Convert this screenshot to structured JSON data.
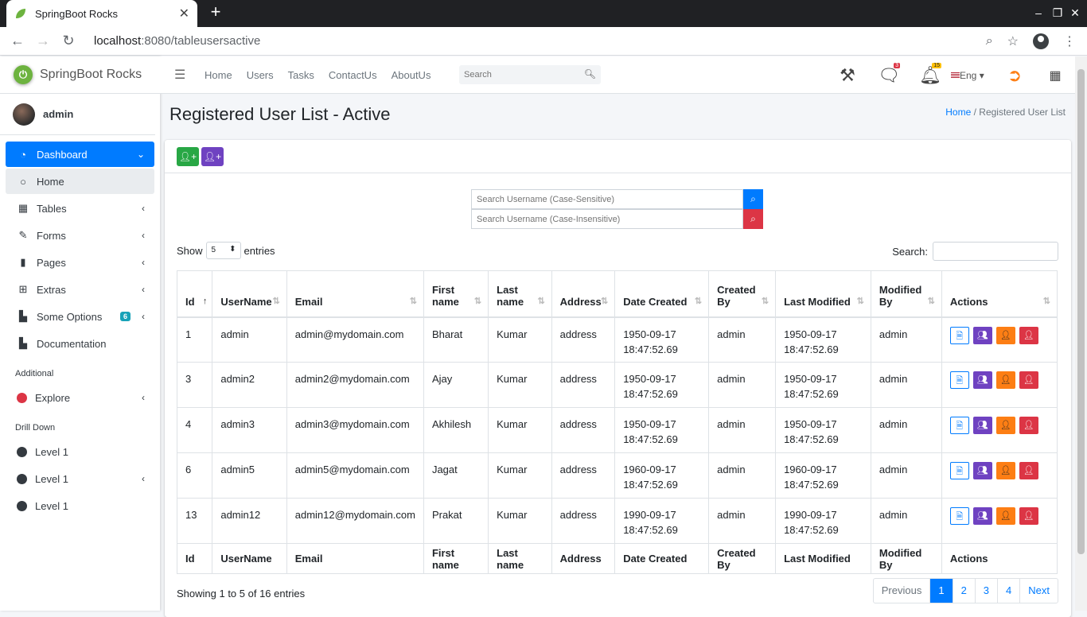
{
  "browser": {
    "tab_title": "SpringBoot Rocks",
    "url_host": "localhost",
    "url_path": ":8080/tableusersactive"
  },
  "sidebar": {
    "brand": "SpringBoot Rocks",
    "user": "admin",
    "items": [
      {
        "label": "Dashboard",
        "icon": "tachometer-icon"
      },
      {
        "label": "Home",
        "icon": "circle-icon"
      },
      {
        "label": "Tables",
        "icon": "table-icon"
      },
      {
        "label": "Forms",
        "icon": "edit-icon"
      },
      {
        "label": "Pages",
        "icon": "book-icon"
      },
      {
        "label": "Extras",
        "icon": "plus-square-icon"
      },
      {
        "label": "Some Options",
        "icon": "file-icon",
        "badge": "6"
      },
      {
        "label": "Documentation",
        "icon": "file-icon"
      }
    ],
    "header_additional": "Additional",
    "explore": "Explore",
    "header_drilldown": "Drill Down",
    "levels": [
      "Level 1",
      "Level 1",
      "Level 1"
    ]
  },
  "topnav": {
    "links": [
      "Home",
      "Users",
      "Tasks",
      "ContactUs",
      "AboutUs"
    ],
    "search_placeholder": "Search",
    "messages_badge": "3",
    "notifications_badge": "15",
    "language": "Eng"
  },
  "page": {
    "title": "Registered User List - Active",
    "breadcrumb_home": "Home",
    "breadcrumb_current": "Registered User List"
  },
  "search": {
    "case_sensitive_placeholder": "Search Username (Case-Sensitive)",
    "case_insensitive_placeholder": "Search Username (Case-Insensitive)"
  },
  "datatable": {
    "show_label": "Show",
    "page_length": "5",
    "entries_label": "entries",
    "search_label": "Search:",
    "columns": [
      "Id",
      "UserName",
      "Email",
      "First name",
      "Last name",
      "Address",
      "Date Created",
      "Created By",
      "Last Modified",
      "Modified By",
      "Actions"
    ],
    "rows": [
      [
        "1",
        "admin",
        "admin@mydomain.com",
        "Bharat",
        "Kumar",
        "address",
        "1950-09-17 18:47:52.69",
        "admin",
        "1950-09-17 18:47:52.69",
        "admin"
      ],
      [
        "3",
        "admin2",
        "admin2@mydomain.com",
        "Ajay",
        "Kumar",
        "address",
        "1950-09-17 18:47:52.69",
        "admin",
        "1950-09-17 18:47:52.69",
        "admin"
      ],
      [
        "4",
        "admin3",
        "admin3@mydomain.com",
        "Akhilesh",
        "Kumar",
        "address",
        "1950-09-17 18:47:52.69",
        "admin",
        "1950-09-17 18:47:52.69",
        "admin"
      ],
      [
        "6",
        "admin5",
        "admin5@mydomain.com",
        "Jagat",
        "Kumar",
        "address",
        "1960-09-17 18:47:52.69",
        "admin",
        "1960-09-17 18:47:52.69",
        "admin"
      ],
      [
        "13",
        "admin12",
        "admin12@mydomain.com",
        "Prakat",
        "Kumar",
        "address",
        "1990-09-17 18:47:52.69",
        "admin",
        "1990-09-17 18:47:52.69",
        "admin"
      ]
    ],
    "info": "Showing 1 to 5 of 16 entries",
    "pager": [
      "Previous",
      "1",
      "2",
      "3",
      "4",
      "Next"
    ]
  },
  "colors": {
    "primary": "#007bff",
    "success": "#28a745",
    "purple": "#6f42c1",
    "orange": "#fd7e14",
    "danger": "#dc3545",
    "info": "#17a2b8"
  }
}
